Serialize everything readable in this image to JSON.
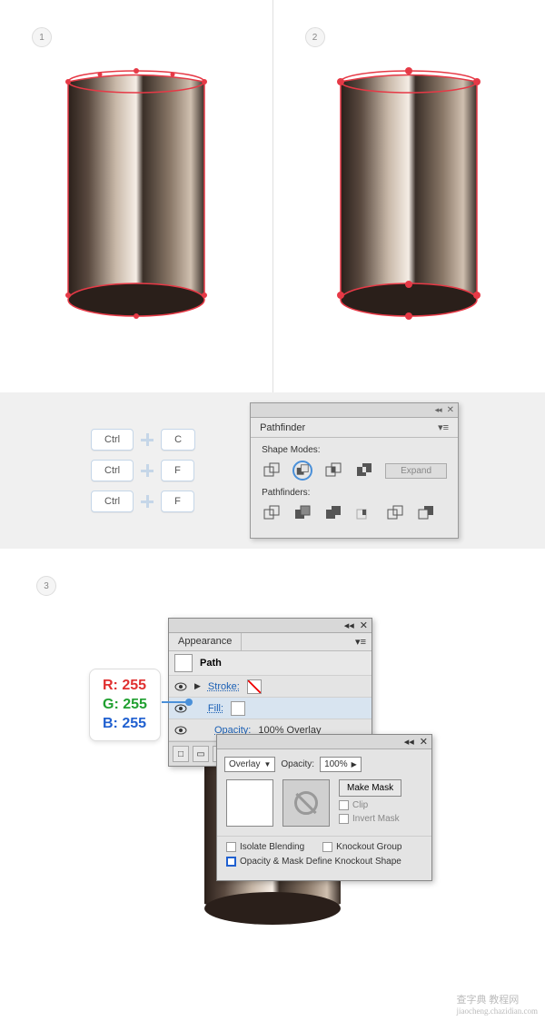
{
  "steps": {
    "s1": "1",
    "s2": "2",
    "s3": "3"
  },
  "shortcuts": [
    {
      "mod": "Ctrl",
      "key": "C"
    },
    {
      "mod": "Ctrl",
      "key": "F"
    },
    {
      "mod": "Ctrl",
      "key": "F"
    }
  ],
  "pathfinder": {
    "title": "Pathfinder",
    "shapeModesLabel": "Shape Modes:",
    "pathfindersLabel": "Pathfinders:",
    "expand": "Expand"
  },
  "appearance": {
    "title": "Appearance",
    "path": "Path",
    "stroke": "Stroke:",
    "fill": "Fill:",
    "opacityLabel": "Opacity:",
    "opacityValue": "100% Overlay"
  },
  "transparency": {
    "blendMode": "Overlay",
    "opacityLabel": "Opacity:",
    "opacityValue": "100%",
    "makeMask": "Make Mask",
    "clip": "Clip",
    "invertMask": "Invert Mask",
    "isolateBlending": "Isolate Blending",
    "knockoutGroup": "Knockout Group",
    "knockoutShape": "Opacity & Mask Define Knockout Shape"
  },
  "rgb": {
    "r": "R: 255",
    "g": "G: 255",
    "b": "B: 255"
  },
  "watermark": {
    "main": "查字典 教程网",
    "sub": "jiaocheng.chazidian.com"
  }
}
